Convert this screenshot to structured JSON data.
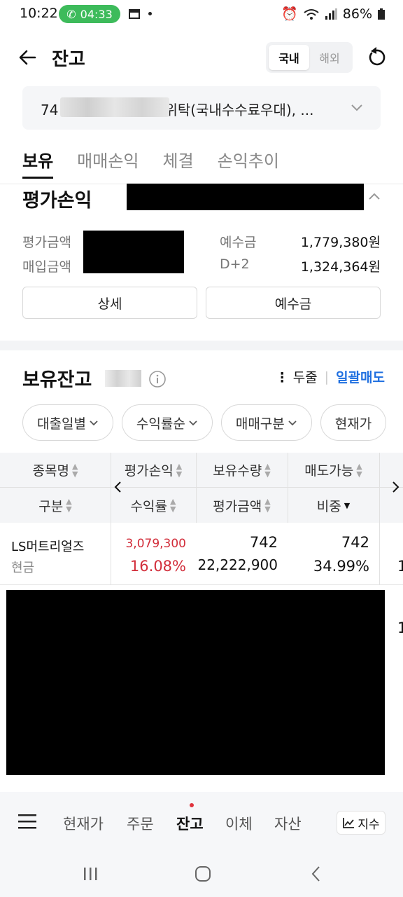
{
  "status_bar": {
    "time": "10:22",
    "call_timer": "04:33",
    "battery": "86%"
  },
  "header": {
    "title": "잔고",
    "segments": [
      "국내",
      "해외"
    ],
    "active_segment": "국내"
  },
  "account": {
    "prefix": "74",
    "suffix": "위탁(국내수수료우대), ..."
  },
  "tabs": [
    "보유",
    "매매손익",
    "체결",
    "손익추이"
  ],
  "evaluation": {
    "title": "평가손익",
    "rows": [
      {
        "label": "평가금액",
        "right_label": "예수금",
        "right_value": "1,779,380원"
      },
      {
        "label": "매입금액",
        "right_label": "D+2",
        "right_value": "1,324,364원"
      }
    ],
    "buttons": [
      "상세",
      "예수금"
    ]
  },
  "holdings": {
    "title": "보유잔고",
    "collapse_label": "두줄",
    "sell_all_label": "일괄매도",
    "filters": [
      "대출일별",
      "수익률순",
      "매매구분",
      "현재가"
    ],
    "columns_row1": [
      "종목명",
      "평가손익",
      "보유수량",
      "매도가능"
    ],
    "columns_row2": [
      "구분",
      "수익률",
      "평가금액",
      "비중"
    ],
    "rows": [
      {
        "name": "LS머트리얼즈",
        "type": "현금",
        "profit": "3,079,300",
        "rate": "16.08%",
        "qty": "742",
        "eval_amount": "22,222,900",
        "sellable": "742",
        "weight": "34.99%",
        "extra": "1"
      }
    ]
  },
  "bottom_nav": {
    "items": [
      "현재가",
      "주문",
      "잔고",
      "이체",
      "자산"
    ],
    "active": "잔고",
    "index_label": "지수"
  },
  "colors": {
    "accent_blue": "#1f6fe0",
    "profit_red": "#d22d3a",
    "call_green": "#3dbb5b"
  }
}
